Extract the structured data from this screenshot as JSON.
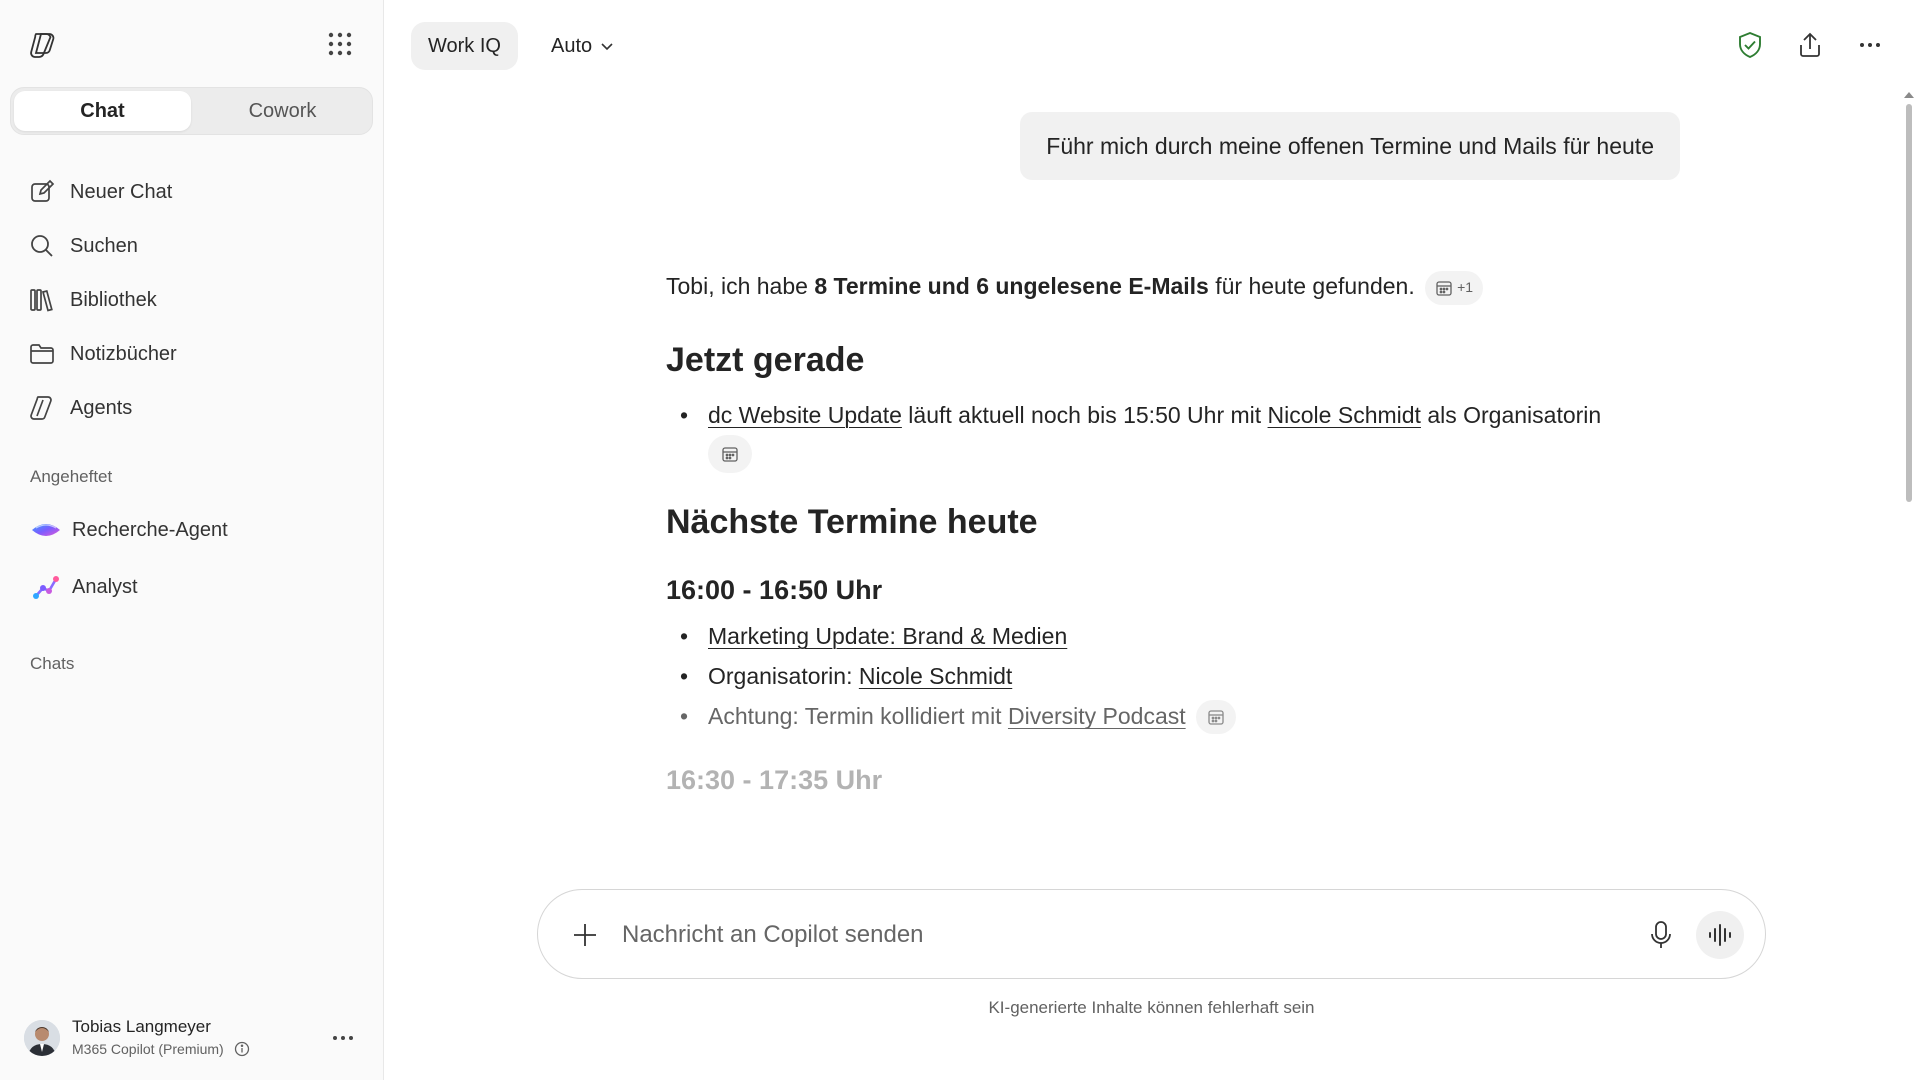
{
  "sidebar": {
    "tabs": {
      "chat": "Chat",
      "cowork": "Cowork"
    },
    "nav": {
      "new_chat": "Neuer Chat",
      "search": "Suchen",
      "library": "Bibliothek",
      "notebooks": "Notizbücher",
      "agents": "Agents"
    },
    "pinned_label": "Angeheftet",
    "pinned": {
      "research": "Recherche-Agent",
      "analyst": "Analyst"
    },
    "chats_label": "Chats",
    "profile": {
      "name": "Tobias Langmeyer",
      "tier": "M365 Copilot (Premium)"
    }
  },
  "header": {
    "mode": "Work IQ",
    "model": "Auto"
  },
  "conversation": {
    "user_message": "Führ mich durch meine offenen Termine und Mails für heute",
    "intro": {
      "pre": "Tobi, ich habe ",
      "bold": "8 Termine und 6 ungelesene E-Mails",
      "post": " für heute gefunden.",
      "cite_count": "+1"
    },
    "now_heading": "Jetzt gerade",
    "now_item": {
      "link1": "dc Website Update",
      "mid": " läuft aktuell noch bis 15:50 Uhr mit ",
      "link2": "Nicole Schmidt",
      "post": " als Organisatorin"
    },
    "next_heading": "Nächste Termine heute",
    "slot1": {
      "time": "16:00 - 16:50 Uhr",
      "title": "Marketing Update: Brand & Medien",
      "organizer_label": "Organisatorin: ",
      "organizer": "Nicole Schmidt",
      "conflict_pre": "Achtung: Termin kollidiert mit ",
      "conflict_link": "Diversity Podcast"
    },
    "slot2": {
      "time": "16:30 - 17:35 Uhr"
    }
  },
  "composer": {
    "placeholder": "Nachricht an Copilot senden",
    "disclaimer": "KI-generierte Inhalte können fehlerhaft sein"
  },
  "colors": {
    "accent": "#2e7d32",
    "text": "#242424"
  },
  "icons": [
    "copilot-logo-icon",
    "app-grid-icon",
    "compose-icon",
    "search-icon",
    "library-icon",
    "folder-icon",
    "agents-icon",
    "shield-check-icon",
    "share-icon",
    "more-icon",
    "chevron-down-icon",
    "calendar-icon",
    "plus-icon",
    "mic-icon",
    "voice-wave-icon",
    "info-icon"
  ]
}
